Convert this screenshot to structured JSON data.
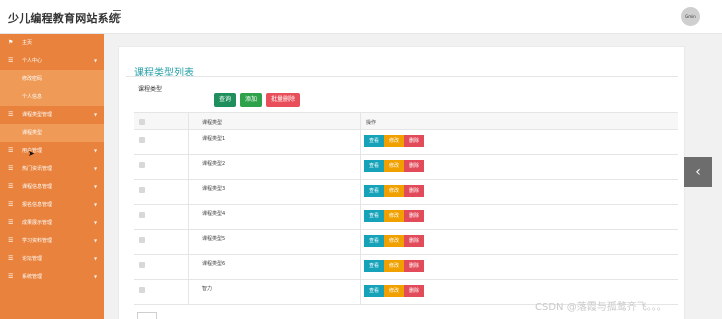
{
  "app": {
    "title": "少儿编程教育网站系统",
    "avatar_text": "Gmin"
  },
  "sidebar": {
    "items": [
      {
        "label": "主页",
        "icon": "flag-icon"
      },
      {
        "label": "个人中心",
        "icon": "list-icon",
        "expanded": true
      },
      {
        "label": "修改密码",
        "sub": true
      },
      {
        "label": "个人信息",
        "sub": true
      },
      {
        "label": "课程类型管理",
        "icon": "list-icon",
        "expanded": true
      },
      {
        "label": "课程类型",
        "sub": true
      },
      {
        "label": "用户管理",
        "icon": "list-icon"
      },
      {
        "label": "热门资讯管理",
        "icon": "list-icon"
      },
      {
        "label": "课程信息管理",
        "icon": "list-icon"
      },
      {
        "label": "报名信息管理",
        "icon": "list-icon"
      },
      {
        "label": "成果展示管理",
        "icon": "list-icon"
      },
      {
        "label": "学习资料管理",
        "icon": "list-icon"
      },
      {
        "label": "论坛管理",
        "icon": "list-icon"
      },
      {
        "label": "系统管理",
        "icon": "list-icon"
      }
    ]
  },
  "main": {
    "page_title": "课程类型列表",
    "filter": {
      "label": "课程类型",
      "value": ""
    },
    "buttons": {
      "search": "查询",
      "add": "添加",
      "batch_delete": "批量删除"
    },
    "table": {
      "headers": {
        "name": "课程类型",
        "ops": "操作"
      },
      "rows": [
        {
          "name": "课程类型1"
        },
        {
          "name": "课程类型2"
        },
        {
          "name": "课程类型3"
        },
        {
          "name": "课程类型4"
        },
        {
          "name": "课程类型5"
        },
        {
          "name": "课程类型6"
        },
        {
          "name": "智力"
        }
      ],
      "op_labels": {
        "view": "查看",
        "edit": "修改",
        "delete": "删除"
      }
    }
  },
  "watermark": "CSDN @落霞与孤鹜齐飞。。。",
  "colors": {
    "sidebar": "#e8823c",
    "title_accent": "#27a0a8",
    "view": "#16a2b8",
    "edit": "#f0a100",
    "delete": "#e24c5a"
  }
}
